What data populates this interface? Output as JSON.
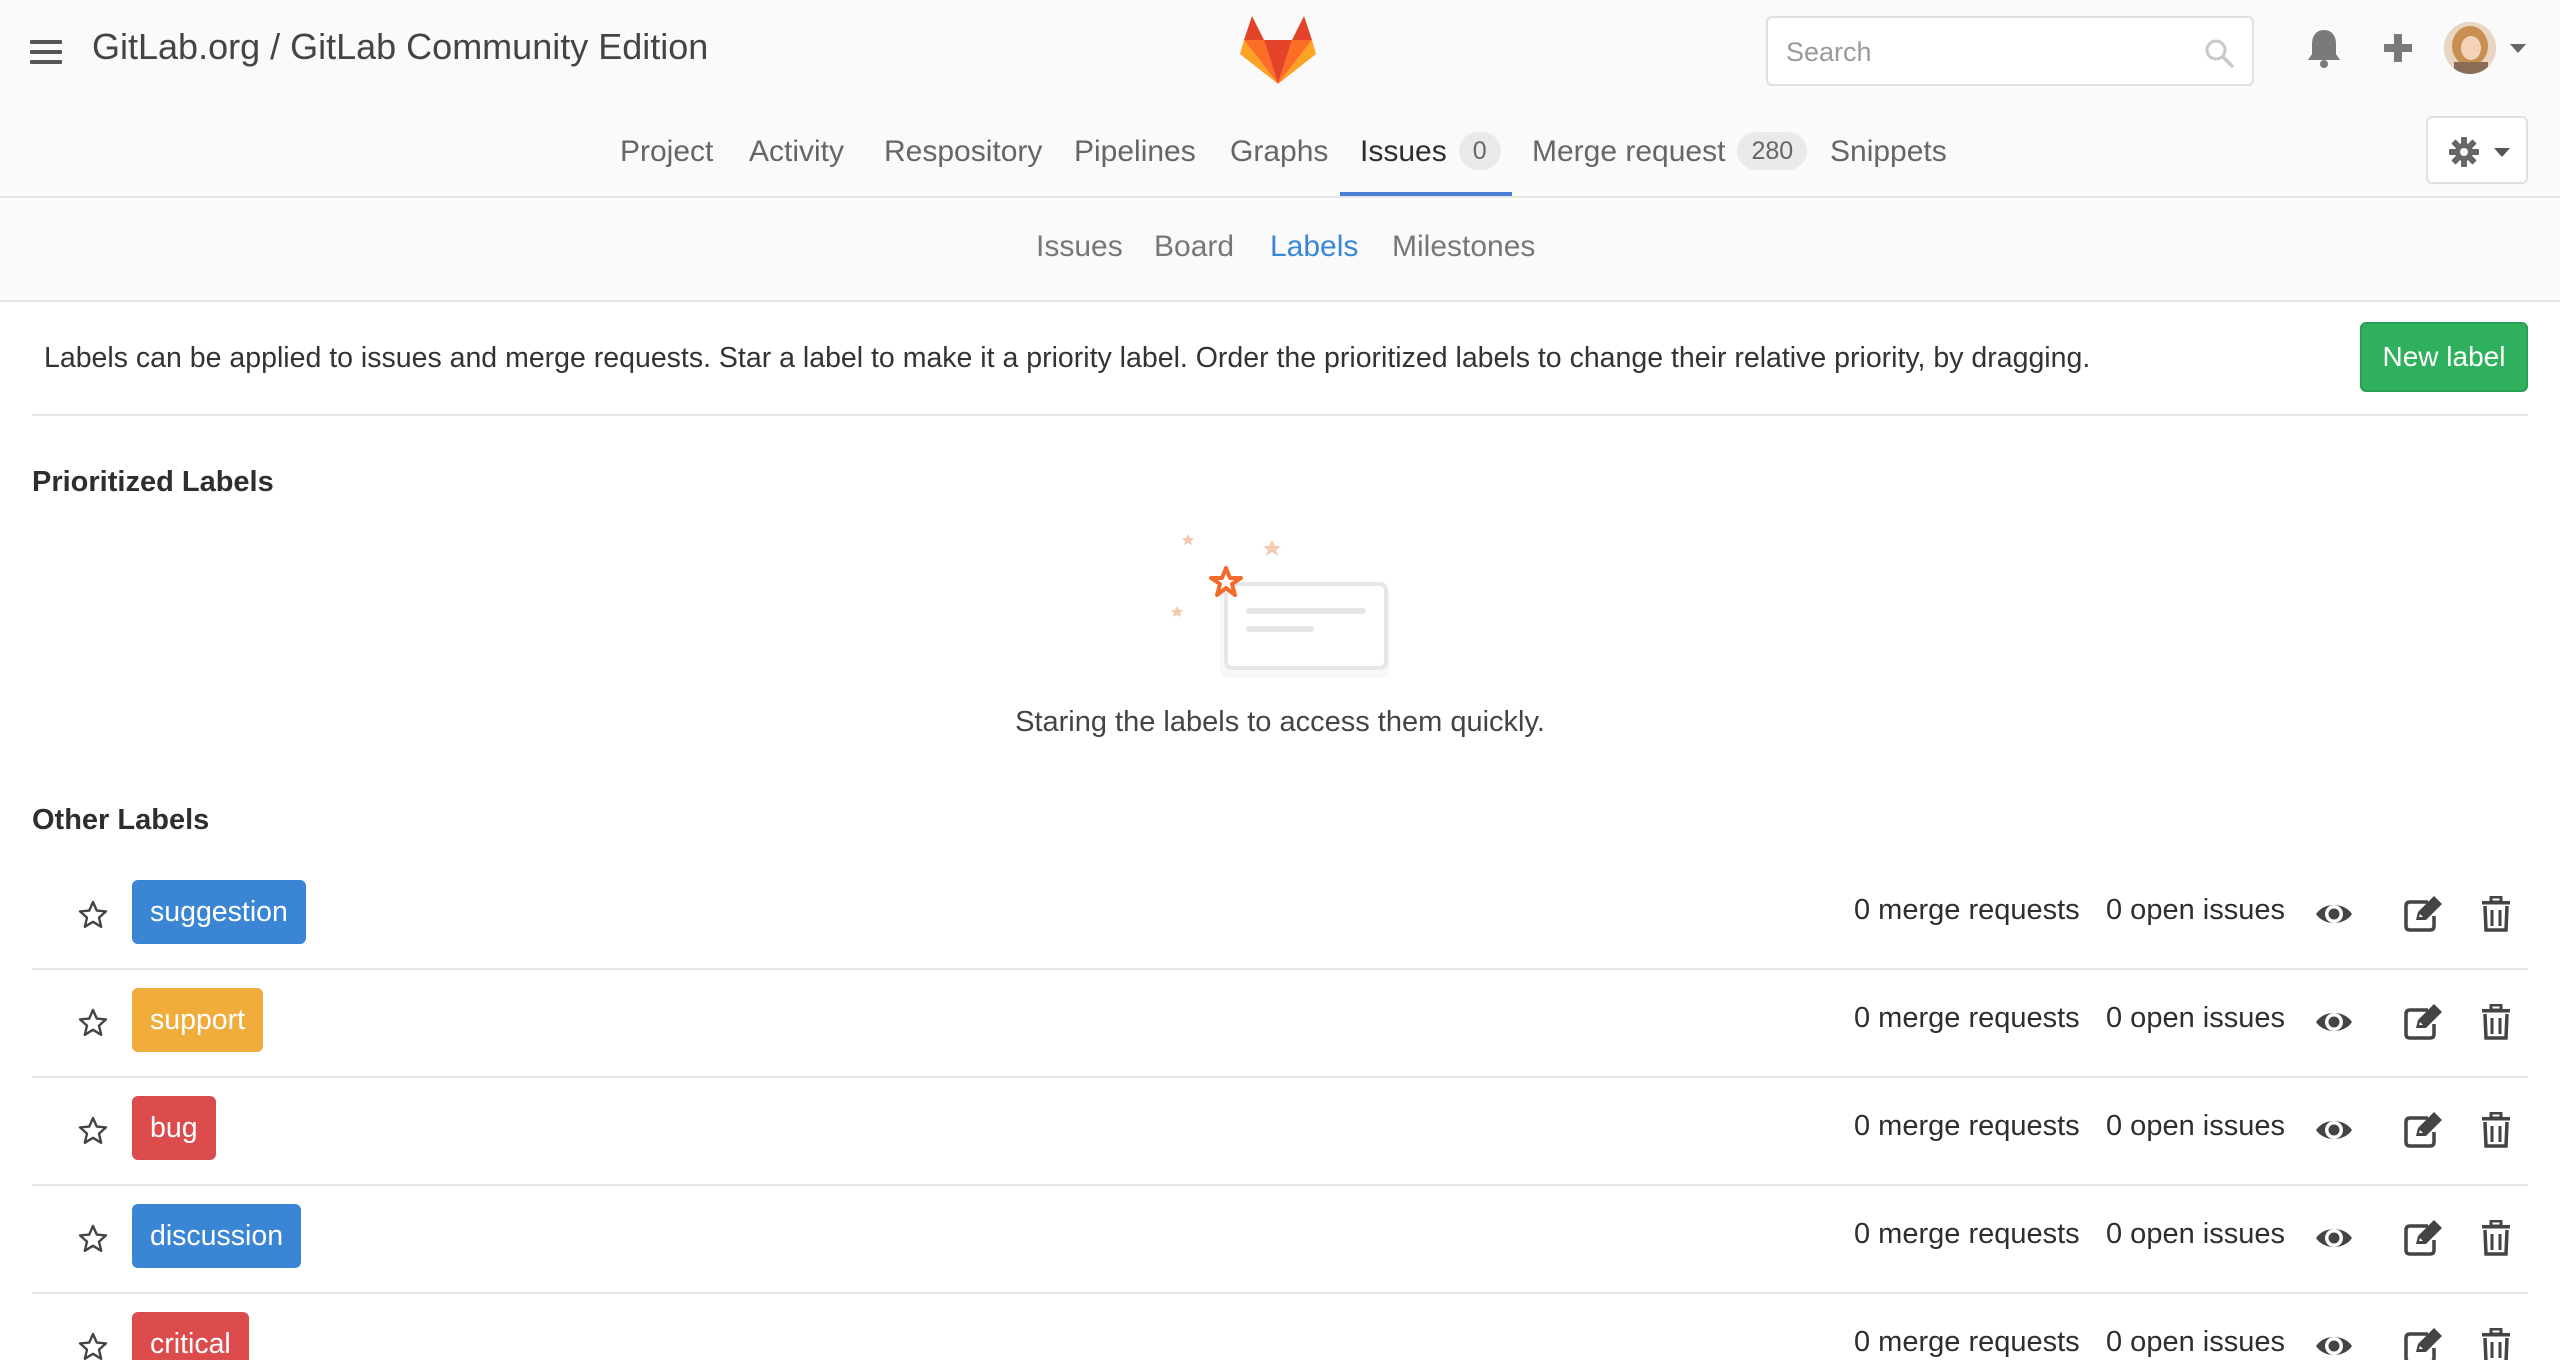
{
  "header": {
    "breadcrumb": "GitLab.org / GitLab Community Edition",
    "search_placeholder": "Search"
  },
  "nav": {
    "project": "Project",
    "activity": "Activity",
    "repository": "Respository",
    "pipelines": "Pipelines",
    "graphs": "Graphs",
    "issues": "Issues",
    "issues_count": "0",
    "merge_request": "Merge request",
    "merge_request_count": "280",
    "snippets": "Snippets"
  },
  "subnav": {
    "issues": "Issues",
    "board": "Board",
    "labels": "Labels",
    "milestones": "Milestones"
  },
  "info": {
    "text": "Labels can be applied to issues and merge requests. Star a label to make it a priority label. Order the prioritized labels to change their relative priority, by dragging.",
    "new_label": "New label"
  },
  "prioritized": {
    "title": "Prioritized Labels",
    "empty_text": "Staring the labels to access them quickly."
  },
  "other": {
    "title": "Other Labels",
    "labels": [
      {
        "name": "suggestion",
        "color": "#3a85d4",
        "merge_requests": "0 merge requests",
        "open_issues": "0 open issues"
      },
      {
        "name": "support",
        "color": "#f0ad3c",
        "merge_requests": "0 merge requests",
        "open_issues": "0 open issues"
      },
      {
        "name": "bug",
        "color": "#dc4c4c",
        "merge_requests": "0 merge requests",
        "open_issues": "0 open issues"
      },
      {
        "name": "discussion",
        "color": "#3a85d4",
        "merge_requests": "0 merge requests",
        "open_issues": "0 open issues"
      },
      {
        "name": "critical",
        "color": "#dc4c4c",
        "merge_requests": "0 merge requests",
        "open_issues": "0 open issues"
      }
    ]
  },
  "colors": {
    "accent_blue": "#3a86d6",
    "nav_underline": "#4a7fd6",
    "success_green": "#2eb05c"
  }
}
